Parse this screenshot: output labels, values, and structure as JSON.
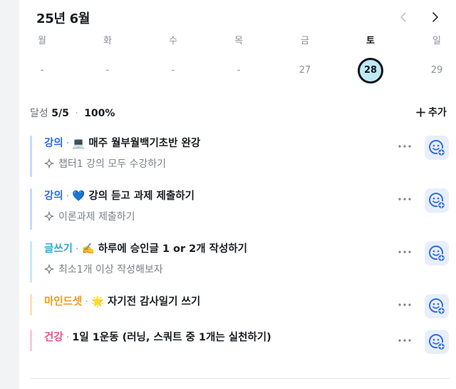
{
  "calendar": {
    "month_title": "25년 6월",
    "days": [
      {
        "name": "월",
        "num": "-"
      },
      {
        "name": "화",
        "num": "-"
      },
      {
        "name": "수",
        "num": "-"
      },
      {
        "name": "목",
        "num": "-"
      },
      {
        "name": "금",
        "num": "27"
      },
      {
        "name": "토",
        "num": "28"
      },
      {
        "name": "일",
        "num": "29"
      }
    ]
  },
  "summary": {
    "label": "달성",
    "count": "5/5",
    "dot": "·",
    "percent": "100%"
  },
  "add_label": "추가",
  "todos": [
    {
      "category": "강의",
      "emoji": "💻",
      "title": "매주 월부월백기초반 완강",
      "sub": "챕터1 강의 모두 수강하기",
      "color": "#2f6ee6",
      "bar": "#c9d8f8"
    },
    {
      "category": "강의",
      "emoji": "💙",
      "title": "강의 듣고 과제 제출하기",
      "sub": "이론과제 제출하기",
      "color": "#2f6ee6",
      "bar": "#c9d8f8"
    },
    {
      "category": "글쓰기",
      "emoji": "✍️",
      "title": "하루에 승인글 1 or 2개 작성하기",
      "sub": "최소1개 이상 작성해보자",
      "color": "#2aa8d8",
      "bar": "#c4e8f4"
    },
    {
      "category": "마인드셋",
      "emoji": "🌟",
      "title": "자기전 감사일기 쓰기",
      "sub": "",
      "color": "#f09a1a",
      "bar": "#fbe0b8"
    },
    {
      "category": "건강",
      "emoji": "",
      "title": "1일 1운동 (러닝, 스쿼트 중 1개는 실천하기)",
      "sub": "",
      "color": "#e8508a",
      "bar": "#f8c9dc"
    }
  ]
}
